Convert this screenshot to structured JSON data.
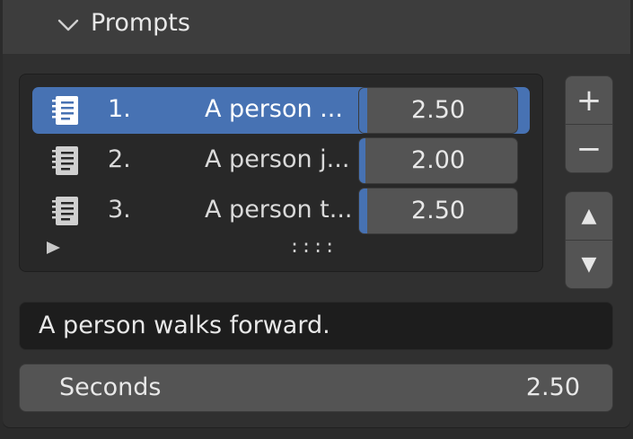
{
  "panel": {
    "title": "Prompts",
    "expanded": true
  },
  "list": {
    "rows": [
      {
        "index": "1.",
        "name": "A person ...",
        "value": "2.50",
        "selected": true,
        "icon": "text-document-icon"
      },
      {
        "index": "2.",
        "name": "A person j...",
        "value": "2.00",
        "selected": false,
        "icon": "text-document-icon"
      },
      {
        "index": "3.",
        "name": "A person t...",
        "value": "2.50",
        "selected": false,
        "icon": "text-document-icon"
      }
    ],
    "grip": "::::"
  },
  "side_buttons": {
    "add": "+",
    "remove": "−",
    "move_up": "▲",
    "move_down": "▼"
  },
  "prompt_text": {
    "value": "A person walks forward."
  },
  "seconds": {
    "label": "Seconds",
    "value": "2.50"
  },
  "colors": {
    "accent": "#4772b3",
    "panel_bg": "#303030",
    "header_bg": "#3d3d3d",
    "field_bg": "#545454",
    "text_field_bg": "#1d1d1d"
  }
}
